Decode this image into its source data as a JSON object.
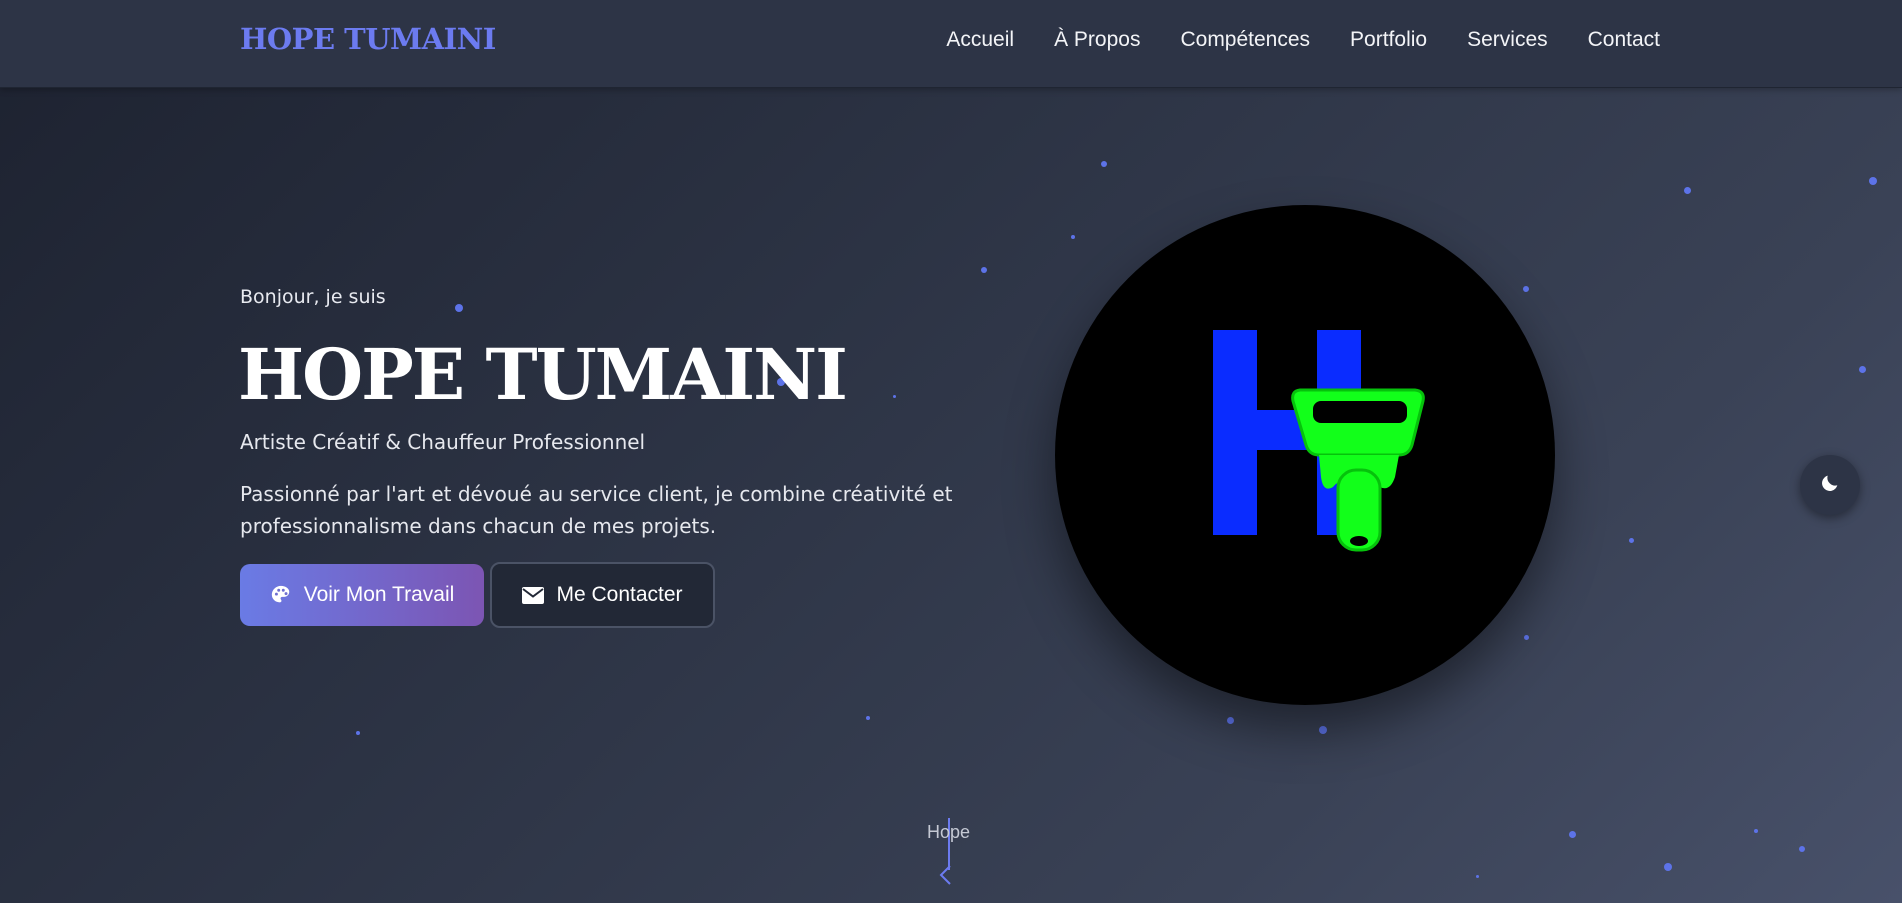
{
  "nav": {
    "logo": "HOPE TUMAINI",
    "links": [
      "Accueil",
      "À Propos",
      "Compétences",
      "Portfolio",
      "Services",
      "Contact"
    ]
  },
  "hero": {
    "greeting": "Bonjour, je suis",
    "name": "HOPE TUMAINI",
    "subtitle": "Artiste Créatif & Chauffeur Professionnel",
    "description": "Passionné par l'art et dévoué au service client, je combine créativité et professionnalisme dans chacun de mes projets.",
    "primary_button": "Voir Mon Travail",
    "secondary_button": "Me Contacter"
  },
  "scroll_indicator": {
    "label": "Hope"
  },
  "icons": {
    "primary_button_icon": "palette-icon",
    "secondary_button_icon": "envelope-icon",
    "theme_toggle_icon": "moon-icon"
  },
  "colors": {
    "accent": "#6c7bf0",
    "logo_blue": "#0a2cff",
    "logo_green": "#12ff1a",
    "button_gradient_start": "#6a7be5",
    "button_gradient_end": "#7c55b3"
  }
}
